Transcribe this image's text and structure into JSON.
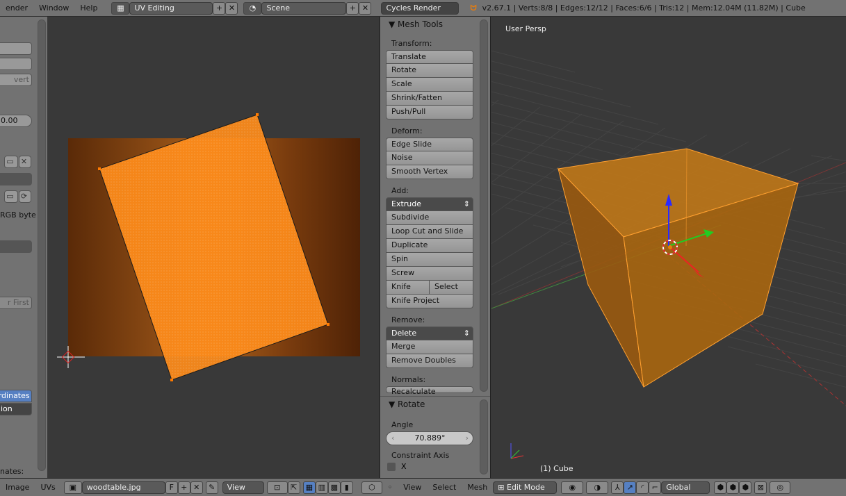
{
  "topbar": {
    "menus": [
      "ender",
      "Window",
      "Help"
    ],
    "screen_layout": "UV Editing",
    "scene": "Scene",
    "render_engine": "Cycles Render",
    "status": "v2.67.1 | Verts:8/8 | Edges:12/12 | Faces:6/6 | Tris:12 | Mem:12.04M (11.82M) | Cube"
  },
  "left_panel": {
    "invert": "vert",
    "value": "0.00",
    "format": "RGB byte",
    "first": "r First",
    "coordinates": "ordinates",
    "option": "ion",
    "coords_label": "nates:"
  },
  "mesh_tools": {
    "title": "Mesh Tools",
    "transform": {
      "label": "Transform:",
      "items": [
        "Translate",
        "Rotate",
        "Scale",
        "Shrink/Fatten",
        "Push/Pull"
      ]
    },
    "deform": {
      "label": "Deform:",
      "items": [
        "Edge Slide",
        "Noise",
        "Smooth Vertex"
      ]
    },
    "add": {
      "label": "Add:",
      "extrude": "Extrude",
      "items": [
        "Subdivide",
        "Loop Cut and Slide",
        "Duplicate",
        "Spin",
        "Screw"
      ],
      "knife": "Knife",
      "select": "Select",
      "knife_project": "Knife Project"
    },
    "remove": {
      "label": "Remove:",
      "delete": "Delete",
      "items": [
        "Merge",
        "Remove Doubles"
      ]
    },
    "normals": {
      "label": "Normals:",
      "items": [
        "Recalculate"
      ]
    }
  },
  "operator": {
    "title": "Rotate",
    "angle_label": "Angle",
    "angle": "70.889°",
    "constraint_label": "Constraint Axis",
    "x_label": "X",
    "x_checked": false
  },
  "viewport": {
    "view_name": "User Persp",
    "object": "(1) Cube"
  },
  "uv_header": {
    "image": "Image",
    "uvs": "UVs",
    "image_name": "woodtable.jpg",
    "fake_user": "F",
    "view": "View"
  },
  "view3d_header": {
    "view": "View",
    "select": "Select",
    "mesh": "Mesh",
    "mode": "Edit Mode",
    "orientation": "Global"
  },
  "colors": {
    "selection": "#ff8c00",
    "header": "#727272",
    "viewport_bg": "#393939",
    "active_blue": "#5680c2"
  }
}
